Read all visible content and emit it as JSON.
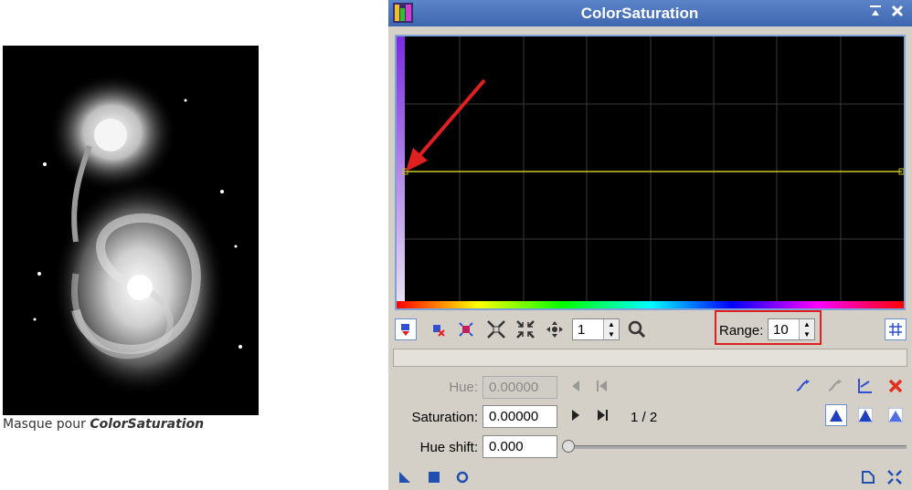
{
  "mask": {
    "caption_prefix": "Masque pour ",
    "caption_bold": "ColorSaturation"
  },
  "window": {
    "title": "ColorSaturation",
    "icons": [
      "app-icon",
      "shade-icon",
      "close-icon"
    ]
  },
  "toolbar": {
    "zoom_value": "1",
    "range_label": "Range:",
    "range_value": "10",
    "icons": [
      "store-curve-icon",
      "delete-point-icon",
      "select-point-icon",
      "zoom-in-icon",
      "zoom-out-icon",
      "pan-icon",
      "zoom-tool-icon",
      "grid-toggle-icon"
    ]
  },
  "params": {
    "hue_label": "Hue:",
    "hue_value": "0.00000",
    "saturation_label": "Saturation:",
    "saturation_value": "0.00000",
    "point_count": "1 / 2",
    "hueshift_label": "Hue shift:",
    "hueshift_value": "0.000"
  },
  "colors": {
    "title_bar": "#3d66b0",
    "curve": "#c8c820",
    "annotation": "#e02020",
    "frame": "#7ea1d8"
  }
}
